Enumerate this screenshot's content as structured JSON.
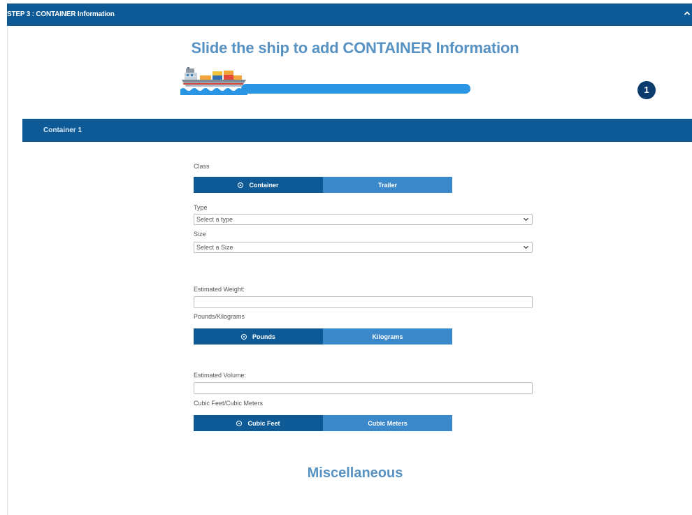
{
  "step_header": {
    "title": "STEP 3 : CONTAINER Information",
    "collapse_icon": "chevron-up-icon"
  },
  "slider": {
    "headline": "Slide the ship to add CONTAINER Information",
    "ship_icon": "cargo-ship-icon",
    "container_count": "1"
  },
  "container_section": {
    "title": "Container 1"
  },
  "form": {
    "class_label": "Class",
    "class_options": {
      "selected": "Container",
      "other": "Trailer"
    },
    "type_label": "Type",
    "type_value": "Select a type",
    "size_label": "Size",
    "size_value": "Select a Size",
    "weight_label": "Estimated Weight:",
    "weight_value": "",
    "weight_unit_label": "Pounds/Kilograms",
    "weight_unit_options": {
      "selected": "Pounds",
      "other": "Kilograms"
    },
    "volume_label": "Estimated Volume:",
    "volume_value": "",
    "volume_unit_label": "Cubic Feet/Cubic Meters",
    "volume_unit_options": {
      "selected": "Cubic Feet",
      "other": "Cubic Meters"
    }
  },
  "misc_section": {
    "title": "Miscellaneous"
  },
  "colors": {
    "header_blue": "#0d5a96",
    "toggle_unselected": "#3b88ca",
    "headline": "#5792c3",
    "track": "#2a96e3",
    "badge": "#0c3c6e"
  }
}
